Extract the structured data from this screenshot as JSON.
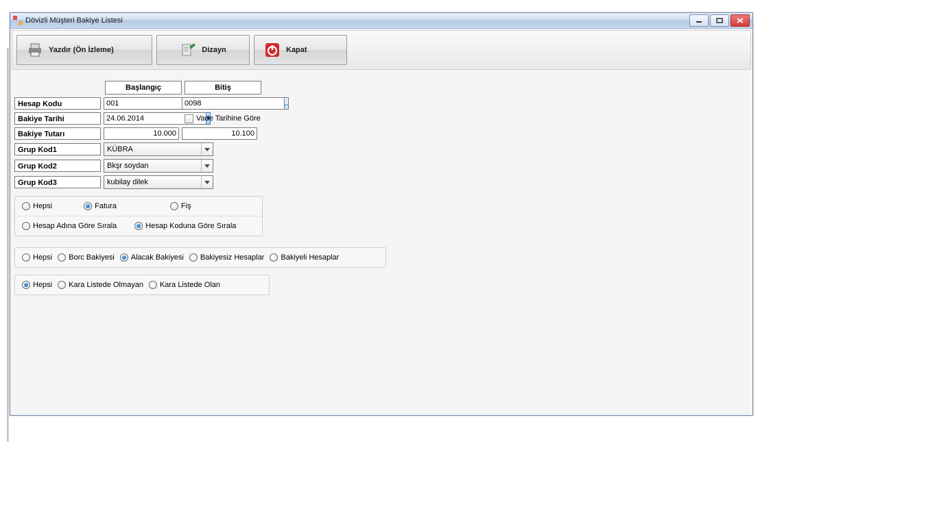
{
  "window": {
    "title": "Dövizli Müşteri Bakiye Listesi"
  },
  "toolbar": {
    "print_label": "Yazdır (Ön İzleme)",
    "design_label": "Dizayn",
    "close_label": "Kapat"
  },
  "columns": {
    "start": "Başlangıç",
    "end": "Bitiş"
  },
  "rows": {
    "hesap_kodu_label": "Hesap Kodu",
    "hesap_kodu_start": "001",
    "hesap_kodu_end": "0098",
    "bakiye_tarihi_label": "Bakiye Tarihi",
    "bakiye_tarihi_value": "24.06.2014",
    "vade_tarihine_gore": "Vade Tarihine Göre",
    "bakiye_tutari_label": "Bakiye Tutarı",
    "bakiye_tutari_start": "10.000",
    "bakiye_tutari_end": "10.100",
    "grup1_label": "Grup Kod1",
    "grup1_value": "KÜBRA",
    "grup2_label": "Grup Kod2",
    "grup2_value": "Bkşr soydan",
    "grup3_label": "Grup Kod3",
    "grup3_value": "kubilay dilek"
  },
  "radios1": {
    "hepsi": "Hepsi",
    "fatura": "Fatura",
    "fis": "Fiş",
    "selected": "fatura"
  },
  "radios2": {
    "ad": "Hesap Adına Göre Sırala",
    "kod": "Hesap Koduna Göre Sırala",
    "selected": "kod"
  },
  "radios3": {
    "hepsi": "Hepsi",
    "borc": "Borc Bakiyesi",
    "alacak": "Alacak Bakiyesi",
    "bakiyesiz": "Bakiyesiz Hesaplar",
    "bakiyeli": "Bakiyeli Hesaplar",
    "selected": "alacak"
  },
  "radios4": {
    "hepsi": "Hepsi",
    "olmayan": "Kara Listede Olmayan",
    "olan": "Kara Listede Olan",
    "selected": "hepsi"
  }
}
